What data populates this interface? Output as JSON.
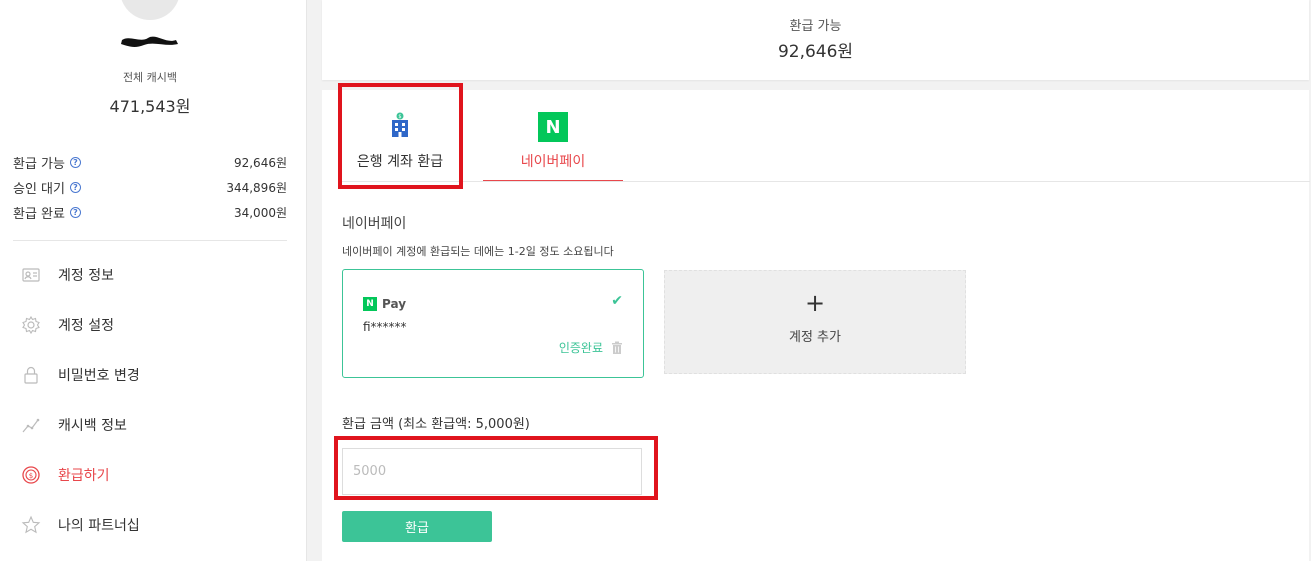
{
  "sidebar": {
    "total_label": "전체 캐시백",
    "total_value": "471,543원",
    "stats": [
      {
        "label": "환급 가능",
        "value": "92,646원"
      },
      {
        "label": "승인 대기",
        "value": "344,896원"
      },
      {
        "label": "환급 완료",
        "value": "34,000원"
      }
    ],
    "menu": [
      {
        "label": "계정 정보",
        "icon": "id-card-icon"
      },
      {
        "label": "계정 설정",
        "icon": "gear-icon"
      },
      {
        "label": "비밀번호 변경",
        "icon": "lock-icon"
      },
      {
        "label": "캐시백 정보",
        "icon": "chart-line-icon"
      },
      {
        "label": "환급하기",
        "icon": "dollar-coin-icon",
        "active": true
      },
      {
        "label": "나의 파트너십",
        "icon": "star-icon"
      }
    ]
  },
  "top_card": {
    "label": "환급 가능",
    "value": "92,646원"
  },
  "tabs": {
    "bank": "은행 계좌 환급",
    "naver": "네이버페이",
    "naver_icon_letter": "N"
  },
  "naverpay": {
    "title": "네이버페이",
    "description": "네이버페이 계정에 환급되는 데에는 1-2일 정도 소요됩니다",
    "account": {
      "badge_letter": "N",
      "badge_text": "Pay",
      "id": "fi******",
      "status": "인증완료"
    },
    "add_account": {
      "plus": "+",
      "label": "계정 추가"
    }
  },
  "refund": {
    "label": "환급 금액 (최소 환급액: 5,000원)",
    "placeholder": "5000",
    "button": "환급"
  },
  "colors": {
    "accent_red": "#e8474b",
    "accent_green": "#3cc497",
    "naver_green": "#03c75a",
    "highlight_red": "#e0141d"
  }
}
